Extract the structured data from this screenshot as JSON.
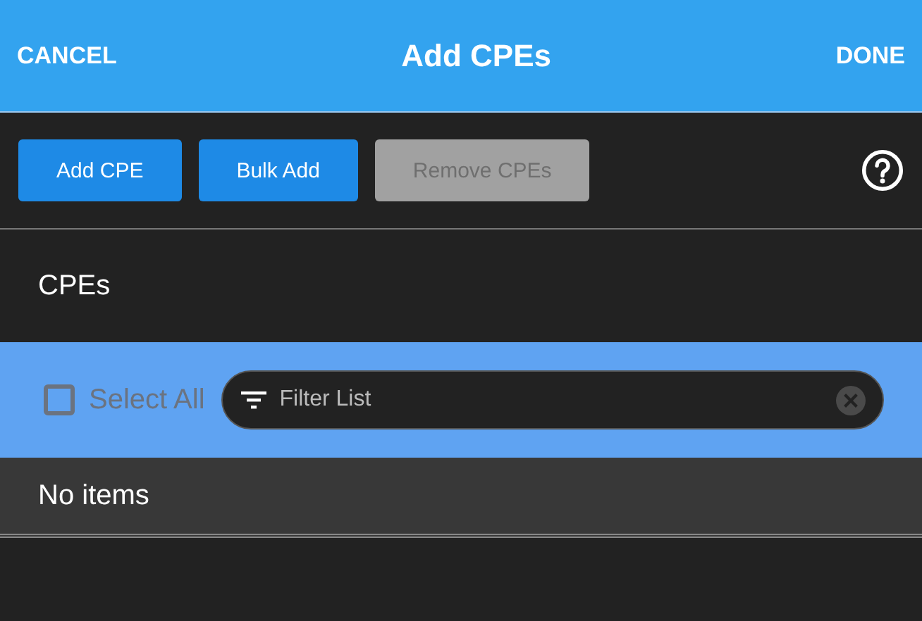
{
  "header": {
    "cancel": "CANCEL",
    "title": "Add CPEs",
    "done": "DONE"
  },
  "toolbar": {
    "buttons": [
      {
        "label": "Add CPE",
        "disabled": false
      },
      {
        "label": "Bulk Add",
        "disabled": false
      },
      {
        "label": "Remove CPEs",
        "disabled": true
      }
    ]
  },
  "section": {
    "title": "CPEs"
  },
  "list_controls": {
    "select_all": {
      "label": "Select All",
      "checked": false,
      "disabled": true
    },
    "filter": {
      "placeholder": "Filter List"
    }
  },
  "list": {
    "empty_text": "No items"
  }
}
